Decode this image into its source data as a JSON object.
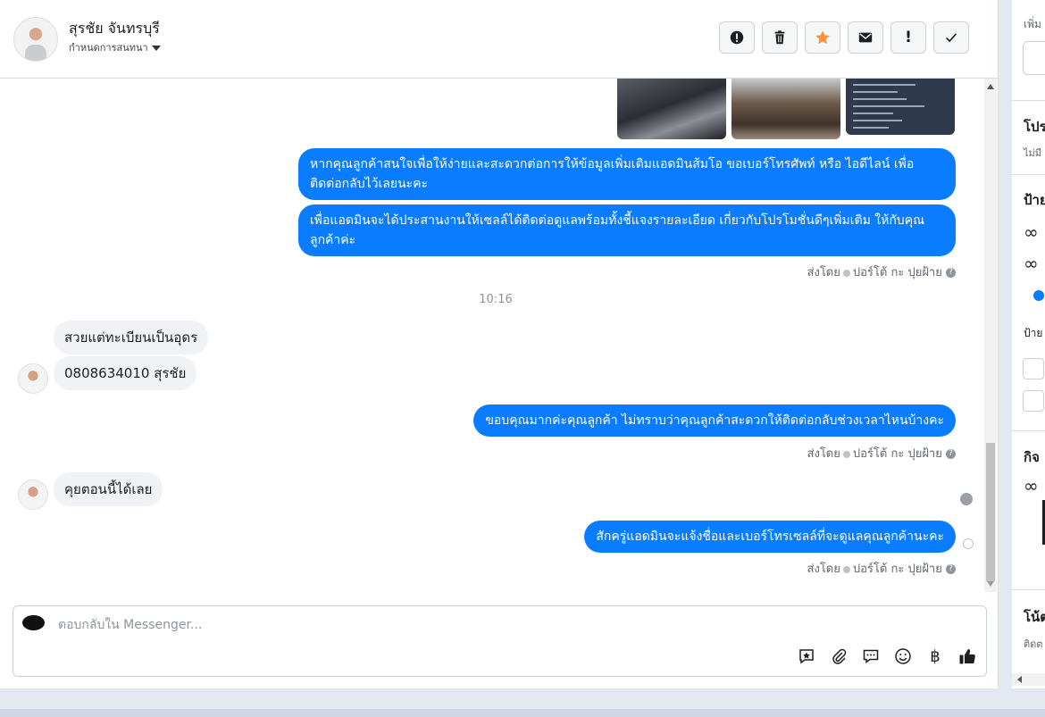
{
  "contact": {
    "name": "สุรชัย จันทรบุรี",
    "assign_label": "กำหนดการสนทนา"
  },
  "toolbar": {
    "buttons": [
      {
        "name": "spam-button",
        "icon": "alert-circle-icon"
      },
      {
        "name": "delete-button",
        "icon": "trash-icon"
      },
      {
        "name": "star-button",
        "icon": "star-icon",
        "color": "#f7923a"
      },
      {
        "name": "mark-unread-button",
        "icon": "envelope-icon"
      },
      {
        "name": "follow-up-button",
        "icon": "exclamation-icon",
        "label": "!"
      },
      {
        "name": "done-button",
        "icon": "checkmark-icon"
      }
    ]
  },
  "messages": {
    "out1": "หากคุณลูกค้าสนใจเพื่อให้ง่ายและสะดวกต่อการให้ข้อมูลเพิ่มเติมแอดมินส้มโอ ขอเบอร์โทรศัพท์ หรือ ไอดีไลน์ เพื่อติดต่อกลับไว้เลยนะคะ",
    "out2": "เพื่อแอดมินจะได้ประสานงานให้เซลล์ได้ติดต่อดูแลพร้อมทั้งชี้แจงรายละเอียด เกี่ยวกับโปรโมชั่นดีๆเพิ่มเติม ให้กับคุณลูกค้าค่ะ",
    "sent_by_1": "ส่งโดย",
    "sender_1": "ปอร์โต้ กะ ปุยฝ้าย",
    "time": "10:16",
    "in1": "สวยแต่ทะเบียนเป็นอุดร",
    "in2": "0808634010 สุรชัย",
    "out3": "ขอบคุณมากค่ะคุณลูกค้า ไม่ทราบว่าคุณลูกค้าสะดวกให้ติดต่อกลับช่วงเวลาไหนบ้างคะ",
    "sent_by_2": "ส่งโดย",
    "sender_2": "ปอร์โต้ กะ ปุยฝ้าย",
    "in3": "คุยตอนนี้ได้เลย",
    "out4": "สักครู่แอดมินจะแจ้งชื่อและเบอร์โทรเซลล์ที่จะดูแลคุณลูกค้านะคะ",
    "sent_by_3": "ส่งโดย",
    "sender_3": "ปอร์โต้ กะ ปุยฝ้าย"
  },
  "composer": {
    "placeholder": "ตอบกลับใน Messenger...",
    "icons": [
      "saved-reply-icon",
      "attachment-icon",
      "chat-bubble-icon",
      "emoji-icon",
      "baht-icon",
      "thumbs-up-icon"
    ],
    "baht_symbol": "฿"
  },
  "right_panel": {
    "items": [
      "เพิ่ม",
      "โปร",
      "ไม่มี",
      "ป้าย",
      "∞",
      "∞",
      "ป้าย",
      "กิจ",
      "∞",
      "โน้ต",
      "ติดต"
    ]
  },
  "colors": {
    "accent": "#0a7cff",
    "star": "#f7923a",
    "incoming_bg": "#f0f2f5"
  }
}
